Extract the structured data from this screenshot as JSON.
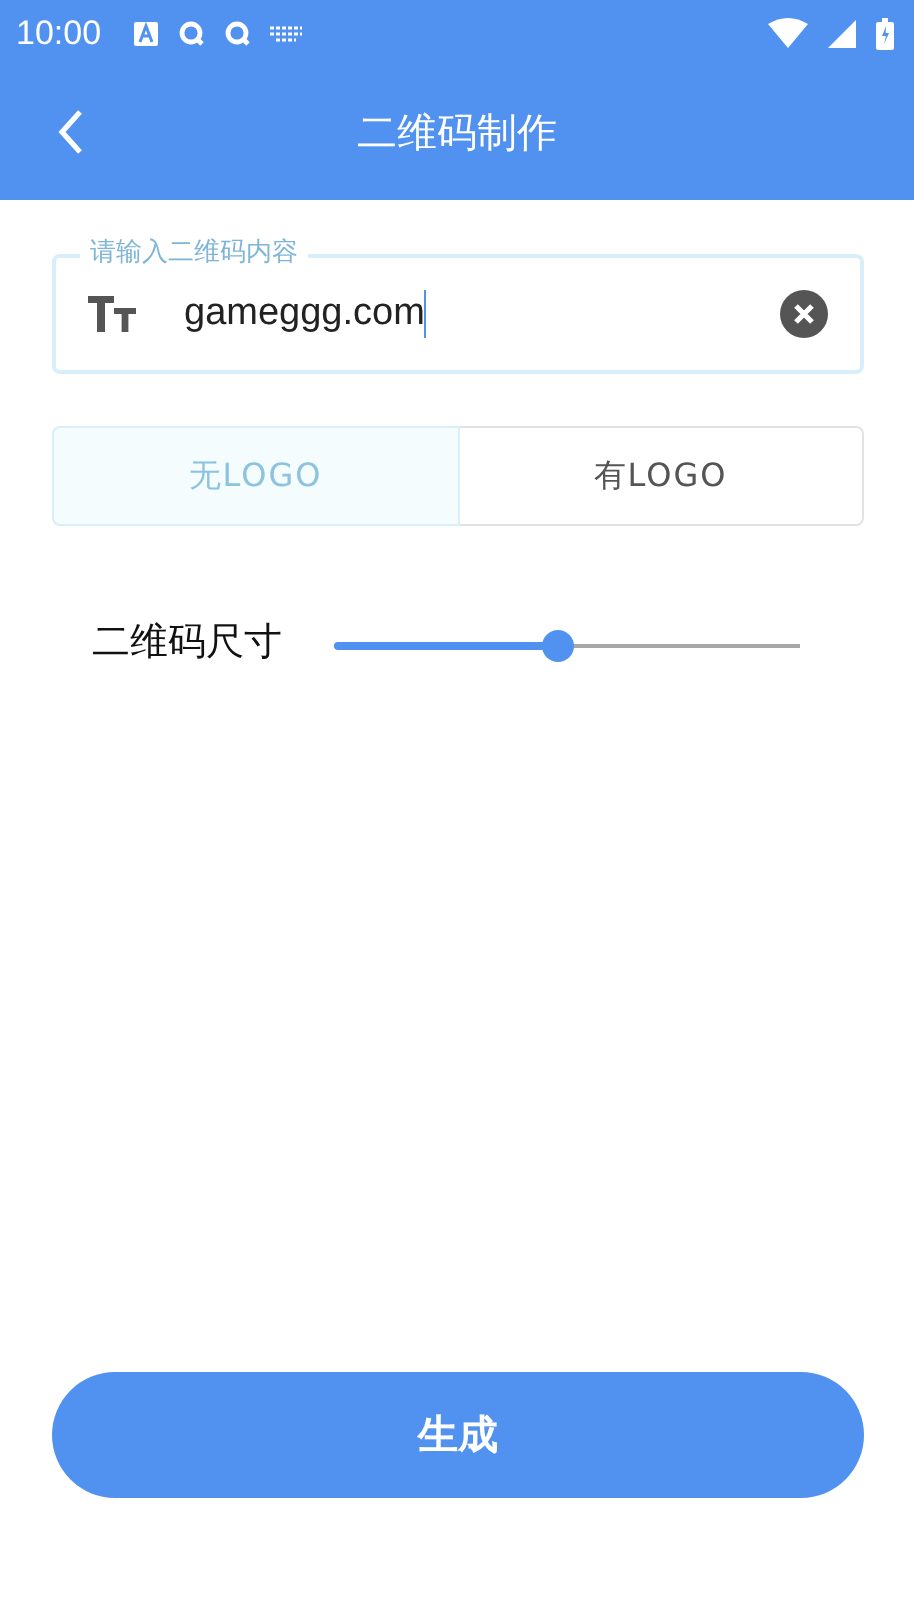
{
  "status_bar": {
    "time": "10:00"
  },
  "app_bar": {
    "title": "二维码制作"
  },
  "input": {
    "label": "请输入二维码内容",
    "value": "gameggg.com"
  },
  "logo_options": [
    {
      "label": "无LOGO",
      "selected": true
    },
    {
      "label": "有LOGO",
      "selected": false
    }
  ],
  "size_slider": {
    "label": "二维码尺寸",
    "level": 0.48
  },
  "generate_button": {
    "label": "生成"
  }
}
